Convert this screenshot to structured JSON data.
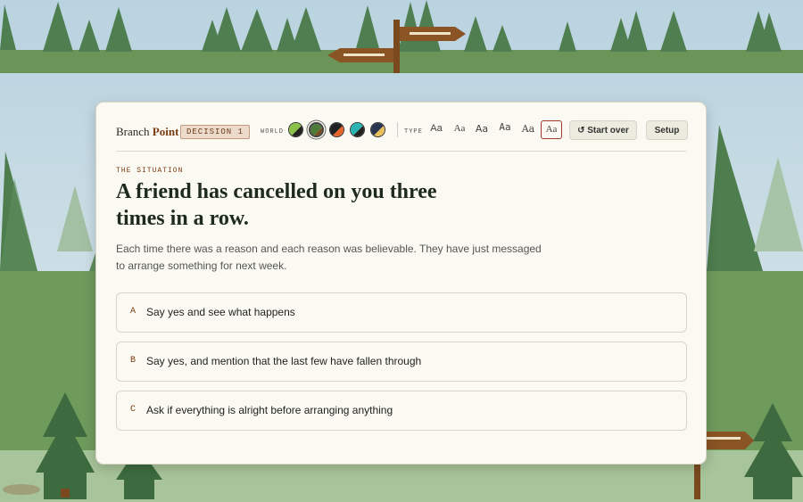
{
  "app": {
    "brand_word1": "Branch",
    "brand_word2": "Point",
    "decision_badge": "DECISION 1"
  },
  "toolbar": {
    "world_label": "WORLD",
    "world_swatches": [
      {
        "name": "lime-black",
        "colors": [
          "#8bc34a",
          "#222222"
        ]
      },
      {
        "name": "forest-brown",
        "colors": [
          "#4e7a3a",
          "#7a4a1e"
        ],
        "selected": true
      },
      {
        "name": "orange-black",
        "colors": [
          "#e8652a",
          "#222222"
        ]
      },
      {
        "name": "teal-black",
        "colors": [
          "#2bb5b0",
          "#222222"
        ]
      },
      {
        "name": "gold-navy",
        "colors": [
          "#e8c05a",
          "#2a3550"
        ]
      }
    ],
    "type_label": "TYPE",
    "type_options": [
      "Aa",
      "Aa",
      "Aa",
      "Aa",
      "Aa",
      "Aa"
    ],
    "start_over": "↺ Start over",
    "setup": "Setup"
  },
  "situation": {
    "label": "THE SITUATION",
    "title": "A friend has cancelled on you three times in a row.",
    "description": "Each time there was a reason and each reason was believable. They have just messaged to arrange something for next week."
  },
  "options": [
    {
      "letter": "A",
      "text": "Say yes and see what happens"
    },
    {
      "letter": "B",
      "text": "Say yes, and mention that the last few have fallen through"
    },
    {
      "letter": "C",
      "text": "Ask if everything is alright before arranging anything"
    }
  ],
  "colors": {
    "accent": "#7a3c10",
    "card": "#faf9f2",
    "sky": "#cfe0ea",
    "grass": "#6e9a5c"
  }
}
